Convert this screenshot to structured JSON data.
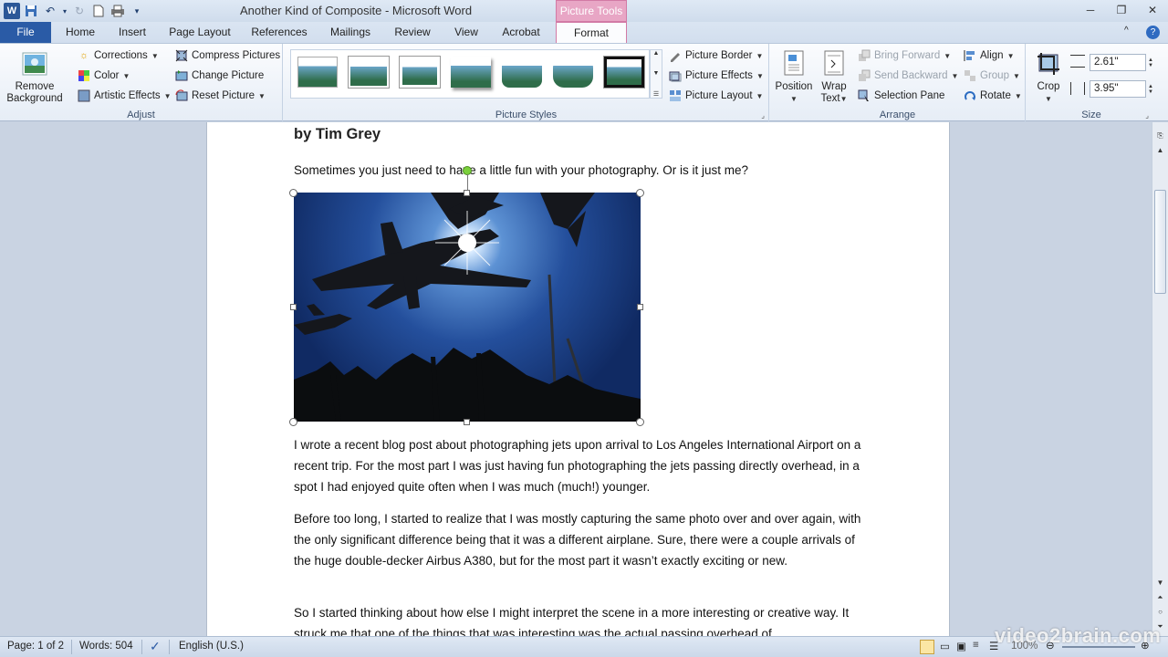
{
  "window": {
    "title": "Another Kind of Composite - Microsoft Word",
    "contextual_tab_group": "Picture Tools"
  },
  "tabs": [
    "File",
    "Home",
    "Insert",
    "Page Layout",
    "References",
    "Mailings",
    "Review",
    "View",
    "Acrobat",
    "Format"
  ],
  "ribbon": {
    "adjust": {
      "label": "Adjust",
      "remove_background": [
        "Remove",
        "Background"
      ],
      "corrections": "Corrections",
      "color": "Color",
      "artistic_effects": "Artistic Effects",
      "compress_pictures": "Compress Pictures",
      "change_picture": "Change Picture",
      "reset_picture": "Reset Picture"
    },
    "picture_styles": {
      "label": "Picture Styles",
      "picture_border": "Picture Border",
      "picture_effects": "Picture Effects",
      "picture_layout": "Picture Layout"
    },
    "arrange": {
      "label": "Arrange",
      "position": "Position",
      "wrap_text": [
        "Wrap",
        "Text"
      ],
      "bring_forward": "Bring Forward",
      "send_backward": "Send Backward",
      "selection_pane": "Selection Pane",
      "align": "Align",
      "group": "Group",
      "rotate": "Rotate"
    },
    "size": {
      "label": "Size",
      "crop": "Crop",
      "height": "2.61\"",
      "width": "3.95\""
    }
  },
  "document": {
    "byline": "by Tim Grey",
    "paragraphs": [
      "Sometimes you just need to have a little fun with your photography. Or is it just me?",
      "I wrote a recent blog post about photographing jets upon arrival to Los Angeles International Airport on a recent trip. For the most part I was just having fun photographing the jets passing directly overhead, in a spot I had enjoyed quite often when I was much (much!) younger.",
      "Before too long, I started to realize that I was mostly capturing the same photo over and over again, with the only significant difference being that it was a different airplane. Sure, there were a couple arrivals of the huge double-decker Airbus A380, but for the most part it wasn’t exactly exciting or new.",
      "So I started thinking about how else I might interpret the scene in a more interesting or creative way. It struck me that one of the things that was interesting was the actual passing overhead of"
    ]
  },
  "statusbar": {
    "page": "Page: 1 of 2",
    "words": "Words: 504",
    "language": "English (U.S.)",
    "zoom": "100%"
  },
  "watermark": "video2brain.com"
}
